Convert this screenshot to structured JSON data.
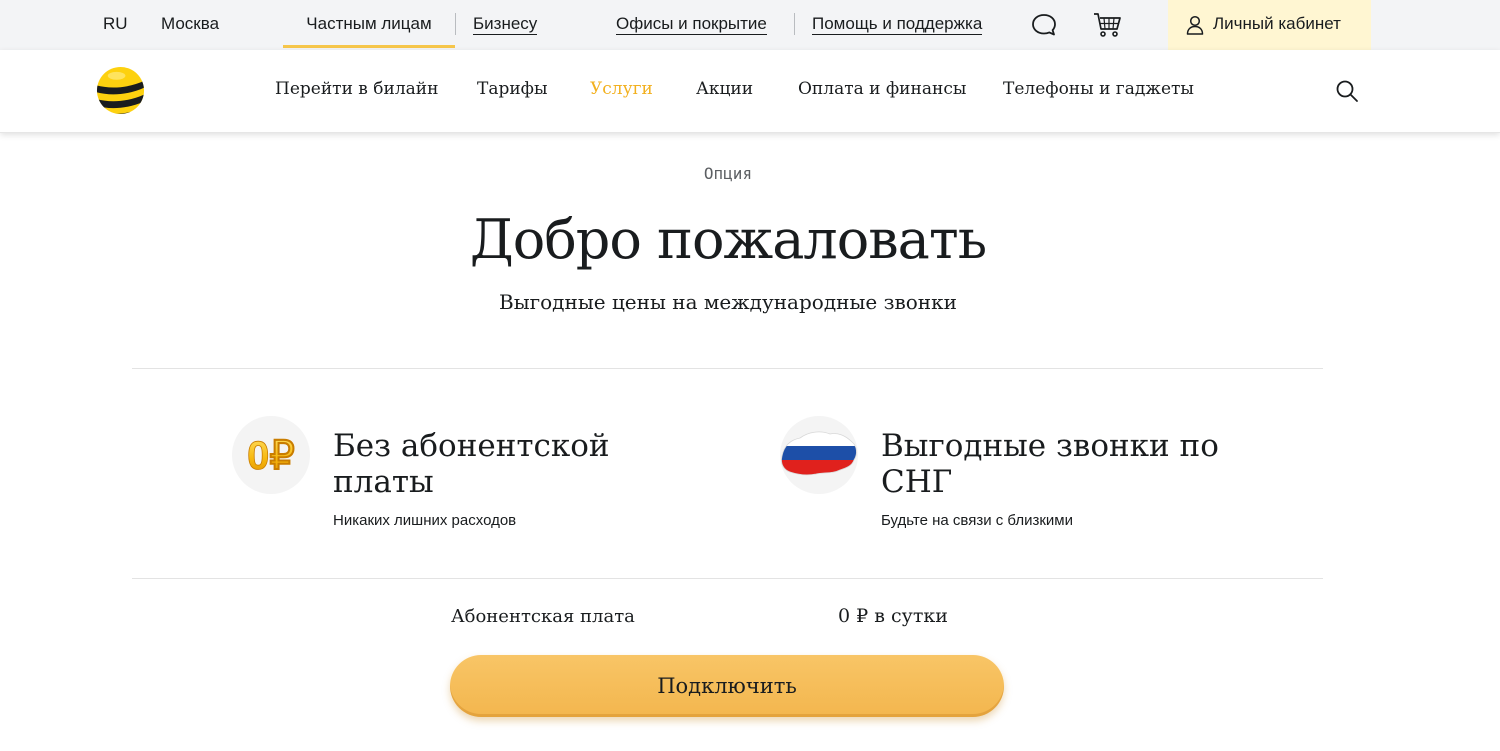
{
  "topbar": {
    "lang": "RU",
    "city": "Москва",
    "segment_private": "Частным лицам",
    "segment_business": "Бизнесу",
    "offices": "Офисы и покрытие",
    "help": "Помощь и поддержка",
    "chat_icon": "chat-bubble-icon",
    "cart_icon": "cart-icon",
    "cabinet": "Личный кабинет",
    "cabinet_bg": "#fff6d2"
  },
  "nav": {
    "logo": "beeline-logo",
    "items": [
      {
        "label": "Перейти в билайн"
      },
      {
        "label": "Тарифы"
      },
      {
        "label": "Услуги",
        "active": true
      },
      {
        "label": "Акции"
      },
      {
        "label": "Оплата и финансы"
      },
      {
        "label": "Телефоны и гаджеты"
      }
    ],
    "active_color": "#f2b01e",
    "search_icon": "search-icon"
  },
  "hero": {
    "eyebrow": "Опция",
    "title": "Добро пожаловать",
    "subtitle": "Выгодные цены на международные звонки"
  },
  "features": [
    {
      "icon": "zero-ruble-icon",
      "icon_text": "0₽",
      "title": "Без абонентской платы",
      "desc": "Никаких лишних расходов"
    },
    {
      "icon": "russia-map-icon",
      "title": "Выгодные звонки по СНГ",
      "desc": "Будьте на связи с близкими"
    }
  ],
  "price": {
    "label": "Абонентская плата",
    "value": "0 ₽ в сутки"
  },
  "cta": {
    "label": "Подключить",
    "color": "#f5bd5a"
  }
}
